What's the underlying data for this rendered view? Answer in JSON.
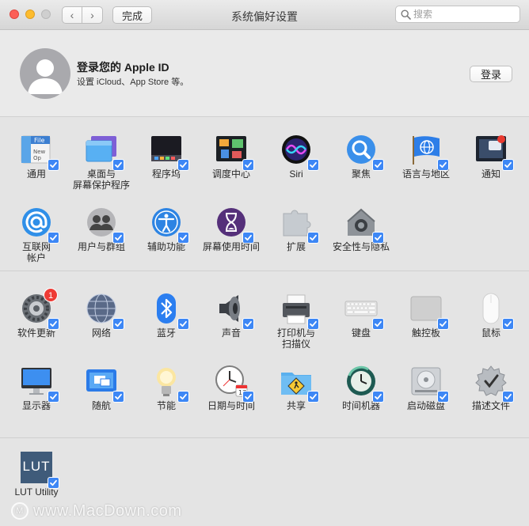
{
  "window": {
    "title": "系统偏好设置",
    "done_label": "完成",
    "back_glyph": "‹",
    "forward_glyph": "›",
    "search_placeholder": "搜索"
  },
  "account": {
    "title": "登录您的 Apple ID",
    "subtitle": "设置 iCloud、App Store 等。",
    "login_label": "登录"
  },
  "sections": {
    "personal": [
      {
        "name": "general",
        "label": "通用",
        "label2": "",
        "icon": "file-new-icon"
      },
      {
        "name": "desktop",
        "label": "桌面与",
        "label2": "屏幕保护程序",
        "icon": "desktop-screensaver-icon"
      },
      {
        "name": "dock",
        "label": "程序坞",
        "label2": "",
        "icon": "dock-icon"
      },
      {
        "name": "mission-control",
        "label": "调度中心",
        "label2": "",
        "icon": "mission-control-icon"
      },
      {
        "name": "siri",
        "label": "Siri",
        "label2": "",
        "icon": "siri-icon"
      },
      {
        "name": "spotlight",
        "label": "聚焦",
        "label2": "",
        "icon": "spotlight-icon"
      },
      {
        "name": "language",
        "label": "语言与地区",
        "label2": "",
        "icon": "language-flag-icon"
      },
      {
        "name": "notifications",
        "label": "通知",
        "label2": "",
        "icon": "notifications-icon"
      },
      {
        "name": "internet-accounts",
        "label": "互联网",
        "label2": "帐户",
        "icon": "at-sign-icon"
      },
      {
        "name": "users-groups",
        "label": "用户与群组",
        "label2": "",
        "icon": "users-icon"
      },
      {
        "name": "accessibility",
        "label": "辅助功能",
        "label2": "",
        "icon": "accessibility-icon"
      },
      {
        "name": "screen-time",
        "label": "屏幕使用时间",
        "label2": "",
        "icon": "hourglass-icon"
      },
      {
        "name": "extensions",
        "label": "扩展",
        "label2": "",
        "icon": "puzzle-icon"
      },
      {
        "name": "security",
        "label": "安全性与隐私",
        "label2": "",
        "icon": "house-lock-icon"
      }
    ],
    "hardware": [
      {
        "name": "software-update",
        "label": "软件更新",
        "label2": "",
        "icon": "gear-icon",
        "badge": "1"
      },
      {
        "name": "network",
        "label": "网络",
        "label2": "",
        "icon": "globe-icon"
      },
      {
        "name": "bluetooth",
        "label": "蓝牙",
        "label2": "",
        "icon": "bluetooth-icon"
      },
      {
        "name": "sound",
        "label": "声音",
        "label2": "",
        "icon": "speaker-icon"
      },
      {
        "name": "printers",
        "label": "打印机与",
        "label2": "扫描仪",
        "icon": "printer-icon"
      },
      {
        "name": "keyboard",
        "label": "键盘",
        "label2": "",
        "icon": "keyboard-icon"
      },
      {
        "name": "trackpad",
        "label": "触控板",
        "label2": "",
        "icon": "trackpad-icon"
      },
      {
        "name": "mouse",
        "label": "鼠标",
        "label2": "",
        "icon": "mouse-icon"
      },
      {
        "name": "displays",
        "label": "显示器",
        "label2": "",
        "icon": "display-icon"
      },
      {
        "name": "sidecar",
        "label": "随航",
        "label2": "",
        "icon": "sidecar-icon"
      },
      {
        "name": "energy",
        "label": "节能",
        "label2": "",
        "icon": "lightbulb-icon"
      },
      {
        "name": "date-time",
        "label": "日期与时间",
        "label2": "",
        "icon": "clock-icon"
      },
      {
        "name": "sharing",
        "label": "共享",
        "label2": "",
        "icon": "sharing-folder-icon"
      },
      {
        "name": "time-machine",
        "label": "时间机器",
        "label2": "",
        "icon": "time-machine-icon"
      },
      {
        "name": "startup-disk",
        "label": "启动磁盘",
        "label2": "",
        "icon": "hard-disk-icon"
      },
      {
        "name": "profiles",
        "label": "描述文件",
        "label2": "",
        "icon": "profiles-badge-icon"
      }
    ],
    "other": [
      {
        "name": "lut-utility",
        "label": "LUT Utility",
        "label2": "",
        "icon": "lut-icon",
        "icon_text": "LUT"
      }
    ]
  },
  "watermark": {
    "text": "www.MacDown.com",
    "logo_text": "M"
  },
  "colors": {
    "check": "#3d87f5",
    "badge": "#ee3b35"
  }
}
